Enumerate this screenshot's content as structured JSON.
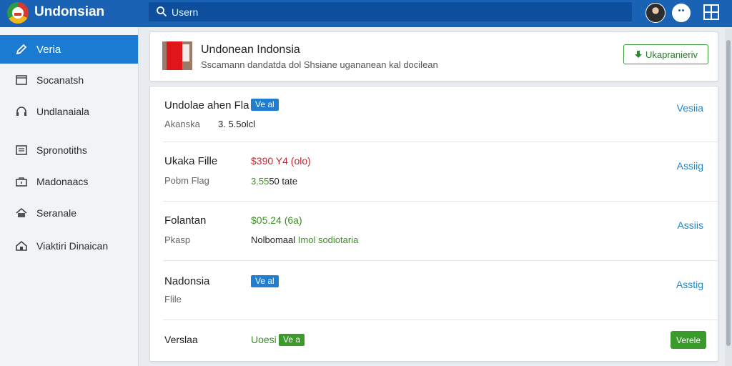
{
  "app": {
    "title": "Undonsian"
  },
  "search": {
    "placeholder": "Usern",
    "value": ""
  },
  "topbar": {
    "avatar": "avatar",
    "icons": [
      "profile-icon",
      "grid-icon"
    ]
  },
  "sidebar": {
    "items": [
      {
        "label": "Veria",
        "icon": "pencil-icon",
        "active": true
      },
      {
        "label": "Socanatsh",
        "icon": "folder-icon",
        "active": false
      },
      {
        "label": "Undlanaiala",
        "icon": "headset-icon",
        "active": false
      },
      {
        "label": "Spronotiths",
        "icon": "document-icon",
        "active": false
      },
      {
        "label": "Madonaacs",
        "icon": "briefcase-icon",
        "active": false
      },
      {
        "label": "Seranale",
        "icon": "home-icon",
        "active": false
      },
      {
        "label": "Viaktiri Dinaican",
        "icon": "house-icon",
        "active": false
      }
    ]
  },
  "header": {
    "title": "Undonean Indonsia",
    "subtitle": "Sscamann dandatda dol Shsiane ugananean kal docilean",
    "export_label": "Ukapranieriv",
    "export_icon": "arrow-down-icon"
  },
  "rows": [
    {
      "name": "Undolae ahen Fla",
      "badge": "Ve al",
      "sub": "Akanska",
      "value2": "3. 5.5olcl",
      "action": "Vesiia"
    },
    {
      "name": "Ukaka Fille",
      "value": "$390 Y4 (olo)",
      "sub": "Pobm Flag",
      "value2_a": "3.55",
      "value2_b": "50 tate",
      "action": "Assiig"
    },
    {
      "name": "Folantan",
      "value": "$05.24 (6a)",
      "sub": "Pkasp",
      "value2_a": "Nolbomaal",
      "value2_b": "Imol sodiotaria",
      "action": "Assiis"
    },
    {
      "name": "Nadonsia",
      "badge": "Ve al",
      "sub": "Flile",
      "action": "Asstig"
    },
    {
      "name": "Verslaa",
      "value": "Uoesi",
      "badge": "Ve a",
      "action": "Verele"
    }
  ],
  "colors": {
    "topbar": "#1a62b3",
    "active_nav": "#1a7bd1",
    "link": "#1f88c9",
    "green": "#3a8f22",
    "red": "#c8252b"
  }
}
